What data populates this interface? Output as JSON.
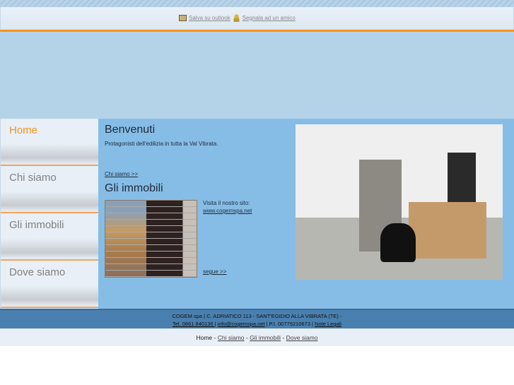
{
  "toolbar": {
    "outlook_label": "Salva su outlook",
    "friend_label": "Segnala ad un amico"
  },
  "sidebar": {
    "items": [
      {
        "label": "Home"
      },
      {
        "label": "Chi siamo"
      },
      {
        "label": "Gli immobili"
      },
      {
        "label": "Dove siamo"
      }
    ]
  },
  "main": {
    "welcome_title": "Benvenuti",
    "welcome_text": "Protagonisti dell'edilizia in tutta la Val Vibrata.",
    "chi_siamo_link": "Chi siamo >>",
    "immobili_title": "Gli immobili",
    "visit_text": "Visita il nostro sito:",
    "site_link": "www.cogemspa.net",
    "segue_link": "segue >>"
  },
  "footer": {
    "line1": "COGEM spa | C. ADRIATICO 113 - SANT'EGIDIO ALLA VIBRATA (TE) -",
    "tel": "Tel. 0861 840136 |",
    "email": "info@cogemspa.net",
    "piva": "| P.I. 00779210673 |",
    "note": "Note Legali"
  },
  "bottom_nav": {
    "home": "Home",
    "chi_siamo": "Chi siamo",
    "immobili": "Gli immobili",
    "dove_siamo": "Dove siamo",
    "sep": " - "
  },
  "colors": {
    "accent": "#f7921e",
    "main_bg": "#86bde6",
    "footer_bg": "#4a80b0"
  }
}
